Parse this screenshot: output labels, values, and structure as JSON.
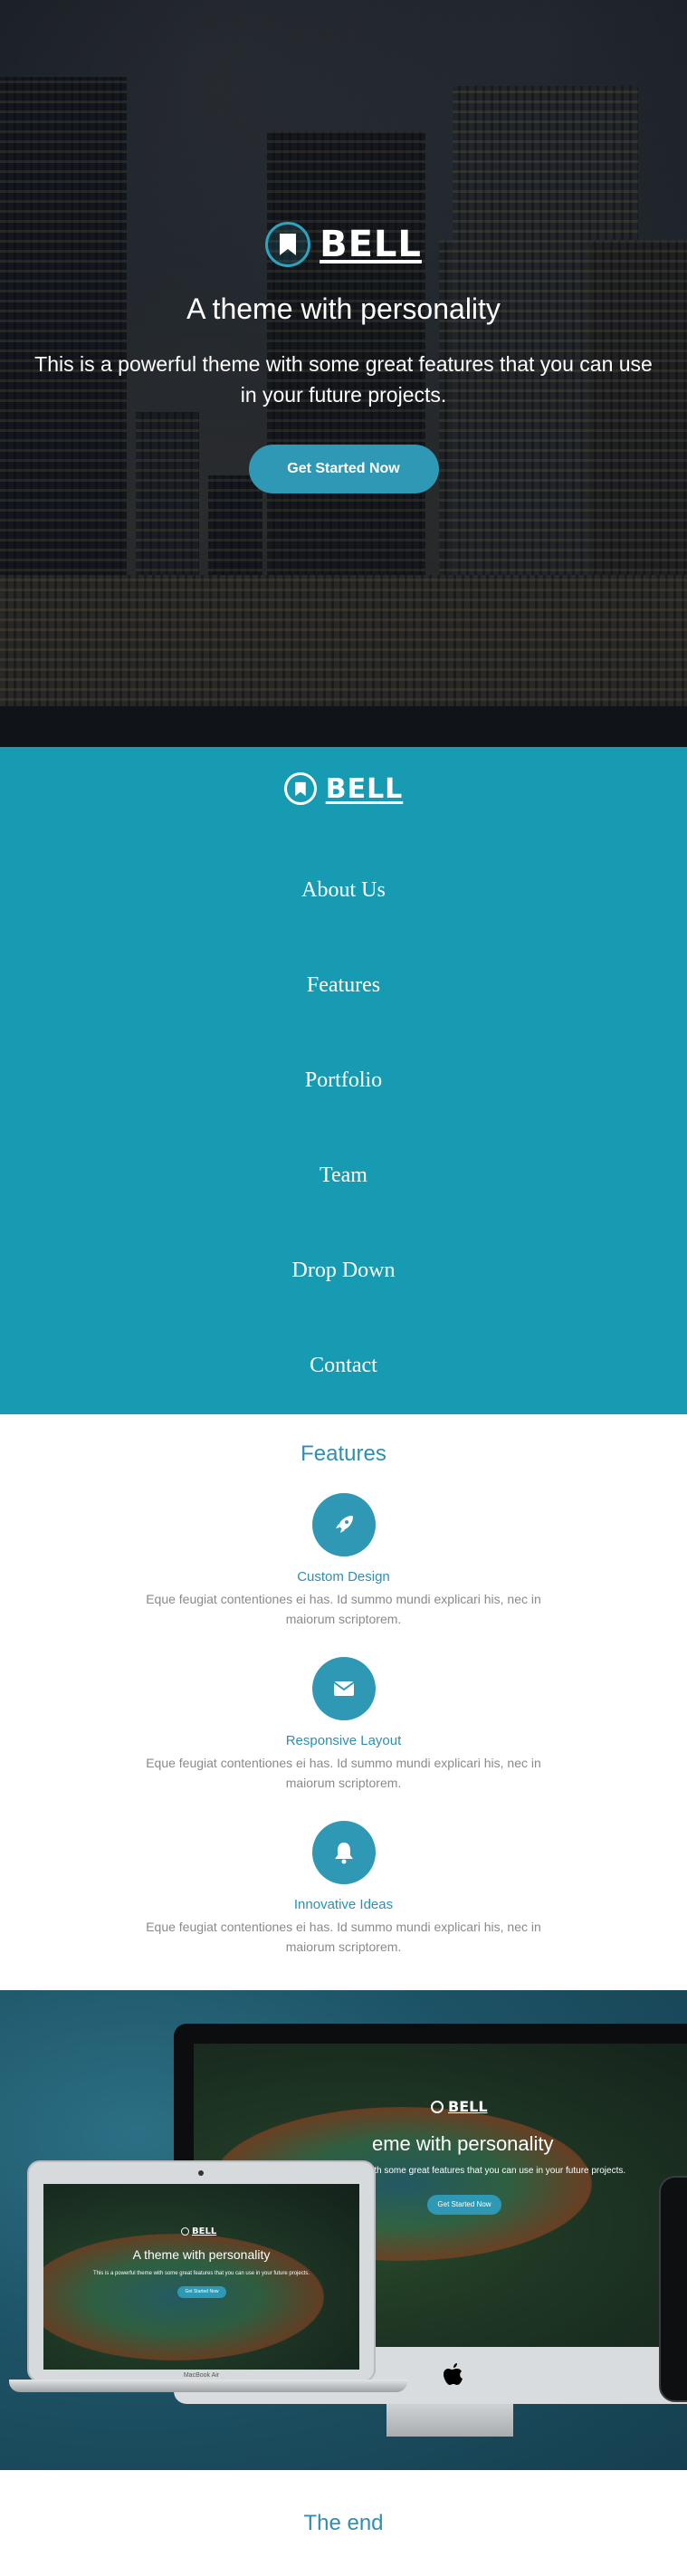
{
  "hero": {
    "logo_text": "BELL",
    "title": "A theme with personality",
    "subtitle": "This is a powerful theme with some great features that you can use in your future projects.",
    "cta_label": "Get Started Now"
  },
  "nav": {
    "logo_text": "BELL",
    "items": [
      {
        "label": "About Us"
      },
      {
        "label": "Features"
      },
      {
        "label": "Portfolio"
      },
      {
        "label": "Team"
      },
      {
        "label": "Drop Down"
      },
      {
        "label": "Contact"
      }
    ]
  },
  "features": {
    "heading": "Features",
    "items": [
      {
        "icon": "rocket-icon",
        "title": "Custom Design",
        "desc": "Eque feugiat contentiones ei has. Id summo mundi explicari his, nec in maiorum scriptorem."
      },
      {
        "icon": "envelope-icon",
        "title": "Responsive Layout",
        "desc": "Eque feugiat contentiones ei has. Id summo mundi explicari his, nec in maiorum scriptorem."
      },
      {
        "icon": "bell-icon",
        "title": "Innovative Ideas",
        "desc": "Eque feugiat contentiones ei has. Id summo mundi explicari his, nec in maiorum scriptorem."
      }
    ]
  },
  "showcase": {
    "imac_logo": "BELL",
    "imac_title": "eme with personality",
    "imac_sub": "ith some great features that you can use in your future projects.",
    "imac_btn": "Get Started Now",
    "laptop_logo": "BELL",
    "laptop_title": "A theme with personality",
    "laptop_sub": "This is a powerful theme with some great features that you can use in your future projects.",
    "laptop_btn": "Get Started Now",
    "laptop_model": "MacBook Air"
  },
  "footer": {
    "the_end": "The end"
  },
  "colors": {
    "accent": "#2f98b5",
    "nav_bg": "#169bb3",
    "heading": "#2f8fb0",
    "muted_text": "#8a8a8a"
  }
}
